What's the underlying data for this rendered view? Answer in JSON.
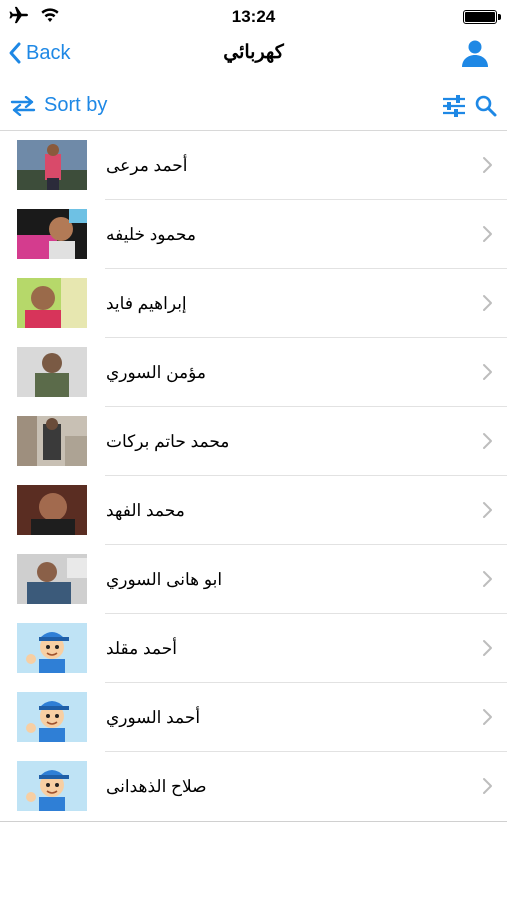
{
  "status": {
    "time": "13:24"
  },
  "nav": {
    "back_label": "Back",
    "title": "كهربائي"
  },
  "toolbar": {
    "sort_label": "Sort by"
  },
  "contacts": [
    {
      "name": "أحمد مرعى",
      "avatar": "photo-person-outdoor"
    },
    {
      "name": "محمود خليفه",
      "avatar": "photo-person-pink"
    },
    {
      "name": "إبراهيم فايد",
      "avatar": "photo-person-green"
    },
    {
      "name": "مؤمن السوري",
      "avatar": "photo-person-light"
    },
    {
      "name": "محمد حاتم بركات",
      "avatar": "photo-person-street"
    },
    {
      "name": "محمد الفهد",
      "avatar": "photo-person-dark"
    },
    {
      "name": "ابو هانى السوري",
      "avatar": "photo-person-smiling"
    },
    {
      "name": "أحمد مقلد",
      "avatar": "cartoon-plumber-avatar"
    },
    {
      "name": "أحمد السوري",
      "avatar": "cartoon-plumber-avatar"
    },
    {
      "name": "صلاح الذهدانى",
      "avatar": "cartoon-plumber-avatar"
    }
  ],
  "colors": {
    "accent": "#1e88e5",
    "separator": "#e2e2e2"
  }
}
